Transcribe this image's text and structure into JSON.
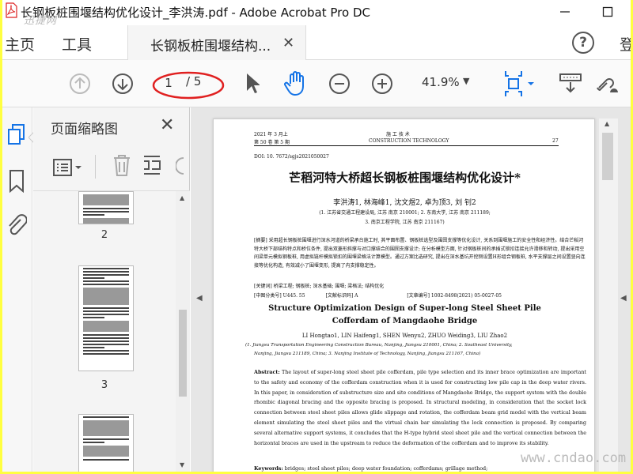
{
  "window": {
    "title": "长钢板桩围堰结构优化设计_李洪涛.pdf - Adobe Acrobat Pro DC",
    "watermark": "迅捷网"
  },
  "tabs": {
    "home": "主页",
    "tools": "工具",
    "document": "长钢板桩围堰结构...",
    "signin": "登"
  },
  "toolbar": {
    "page_current": "1",
    "page_total": "/ 5",
    "zoom": "41.9%"
  },
  "panel": {
    "title": "页面缩略图",
    "thumbnails": [
      {
        "label": "2"
      },
      {
        "label": "3"
      }
    ]
  },
  "doc": {
    "header_left_1": "2021 年 3 月上",
    "header_left_2": "第 50 卷  第 5 期",
    "header_center_1": "施  工  技  术",
    "header_center_2": "CONSTRUCTION TECHNOLOGY",
    "header_right": "27",
    "doi": "DOI: 10. 7672/sgjs2021050027",
    "cn_title": "芒稻河特大桥超长钢板桩围堰结构优化设计*",
    "cn_authors": "李洪涛1, 林海峰1, 沈文煜2, 卓为顶3, 刘  钊2",
    "cn_affil1": "(1. 江苏省交通工程建设局, 江苏  南京  210001; 2. 东南大学, 江苏  南京  211189;",
    "cn_affil2": "3. 南京工程学院, 江苏  南京  211167)",
    "cn_abstract": "[摘要] 采用超长钢板桩围堰进行深水河道的桥梁承台施工时, 其平面布置、钢板桩选型及围囹支撑等优化设计, 关系到围堰施工的安全性和经济性。结合芒稻河特大桥下部结构特点和桥位条件, 提出双菱形斜撑与对口撑结合的围囹支撑设计; 在分析模型方面, 针对钢板桩间的承插式锁扣连接允许滑移和转动, 提出采用空间梁单元模拟钢板桩, 用虚拟链杆模拟锁扣的围堰梁格法计算模型。通过方案比选研究, 提出在深水基坑开挖侧设置H形组合钢板桩, 水平支撑层之间设置竖向连接等优化构造, 有效减小了围堰变形, 提高了内支撑稳定性。",
    "cn_keywords": "[关键词] 桥梁工程; 钢板桩; 深水基础; 围堰; 梁格法; 结构优化",
    "cn_class_1": "[中图分类号] U445. 55",
    "cn_class_2": "[文献标识码] A",
    "cn_class_3": "[文章编号] 1002-8498(2021) 05-0027-05",
    "en_title_1": "Structure Optimization Design of Super-long Steel Sheet Pile",
    "en_title_2": "Cofferdam of Mangdaohe Bridge",
    "en_authors": "LI Hongtao1,  LIN Haifeng1,  SHEN Wenyu2,  ZHUO Weiding3,  LIU Zhao2",
    "en_affil_1": "(1. Jiangsu Transportation Engineering Construction Bureau, Nanjing, Jiangsu  210001, China; 2. Southeast University,",
    "en_affil_2": "Nanjing, Jiangsu  211189, China; 3. Nanjing Institute of Technology, Nanjing, Jiangsu  211167, China)",
    "en_abstract_label": "Abstract:",
    "en_abstract": " The layout of super-long steel sheet pile cofferdam, pile type selection and its inner brace optimization are important to the safety and economy of the cofferdam construction when it is used for constructing low pile cap in the deep water rivers. In this paper, in consideration of substructure size and site conditions of Mangdaohe Bridge, the support system with the double rhombic diagonal bracing and the opposite bracing is proposed. In structural modeling, in consideration that the socket lock connection between steel sheet piles allows glide slippage and rotation, the cofferdam beam grid model with the vertical beam element simulating the steel sheet piles and the virtual chain bar simulating the lock connection is proposed. By comparing several alternative support systems, it concludes that the H-type hybrid steel sheet pile and the vertical connection between the horizontal braces are used in the upstream to reduce the deformation of the cofferdam and to improve its stability.",
    "en_keywords_label": "Keywords:",
    "en_keywords": " bridges; steel sheet piles; deep water foundation; cofferdams; grillage method;"
  },
  "watermark_bottom": "www.cndao.com",
  "colors": {
    "accent_blue": "#1473e6",
    "annotation_red": "#e02020",
    "outer_border": "#ffff40"
  }
}
